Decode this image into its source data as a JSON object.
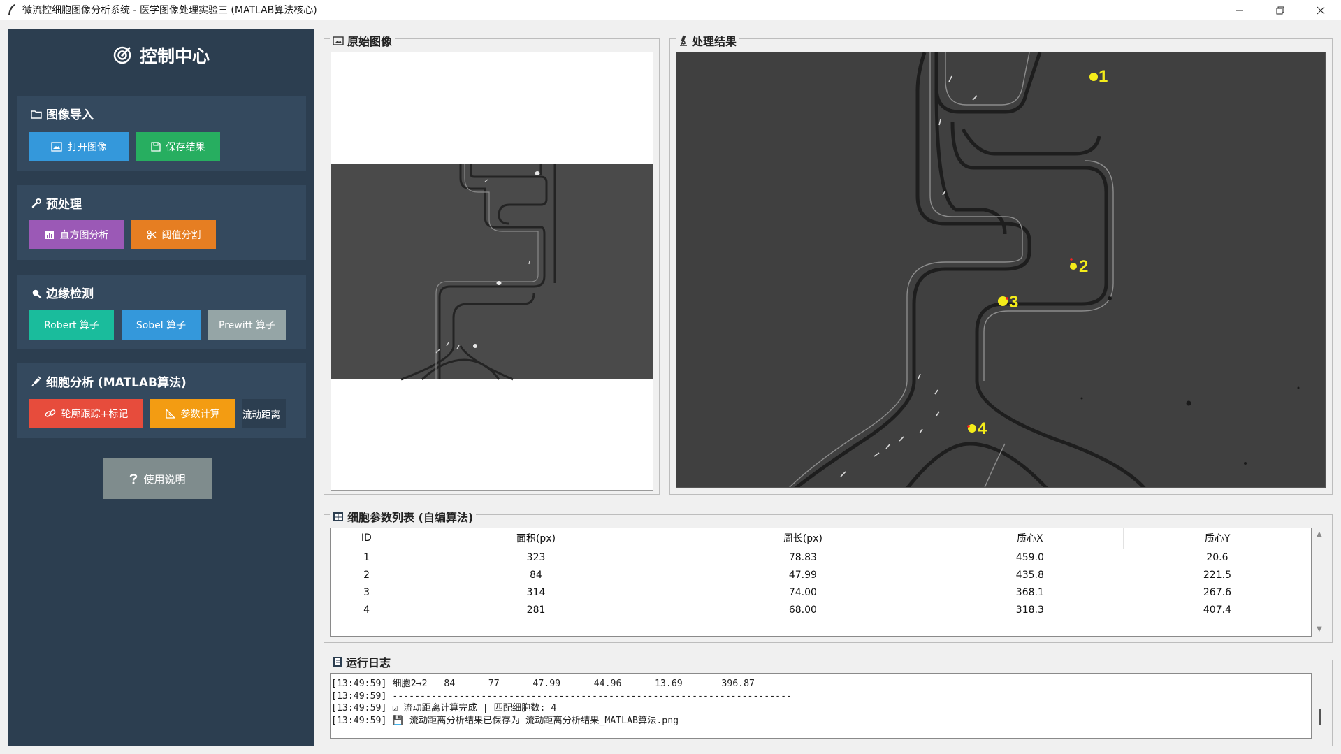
{
  "window": {
    "title": "微流控细胞图像分析系统 - 医学图像处理实验三 (MATLAB算法核心)",
    "controls": [
      "minimize-icon",
      "restore-icon",
      "close-icon"
    ]
  },
  "sidebar": {
    "title": "控制中心",
    "groups": [
      {
        "title": "图像导入",
        "icon": "folder-icon",
        "buttons": [
          {
            "label": "打开图像",
            "icon": "image-icon",
            "color": "#3498db"
          },
          {
            "label": "保存结果",
            "icon": "save-icon",
            "color": "#27ae60"
          }
        ]
      },
      {
        "title": "预处理",
        "icon": "wrench-icon",
        "buttons": [
          {
            "label": "直方图分析",
            "icon": "bar-chart-icon",
            "color": "#9b59b6"
          },
          {
            "label": "阈值分割",
            "icon": "scissors-icon",
            "color": "#e67e22"
          }
        ]
      },
      {
        "title": "边缘检测",
        "icon": "magnifier-icon",
        "buttons": [
          {
            "label": "Robert 算子",
            "color": "#1abc9c"
          },
          {
            "label": "Sobel 算子",
            "color": "#3498db"
          },
          {
            "label": "Prewitt 算子",
            "color": "#95a5a6"
          }
        ]
      },
      {
        "title": "细胞分析 (MATLAB算法)",
        "icon": "syringe-icon",
        "buttons": [
          {
            "label": "轮廓跟踪+标记",
            "icon": "link-icon",
            "color": "#e74c3c"
          },
          {
            "label": "参数计算",
            "icon": "triangle-ruler-icon",
            "color": "#f39c12"
          },
          {
            "label": "流动距离",
            "color": "#2c3e50"
          }
        ]
      }
    ],
    "help_button": {
      "label": "使用说明",
      "icon": "question-icon"
    }
  },
  "original_panel": {
    "label": "原始图像",
    "icon": "photo-icon"
  },
  "result_panel": {
    "label": "处理结果",
    "icon": "microscope-icon",
    "markers": [
      "1",
      "2",
      "3",
      "4"
    ]
  },
  "table_panel": {
    "label": "细胞参数列表 (自编算法)",
    "icon": "table-icon",
    "columns": [
      "ID",
      "面积(px)",
      "周长(px)",
      "质心X",
      "质心Y"
    ],
    "rows": [
      [
        "1",
        "323",
        "78.83",
        "459.0",
        "20.6"
      ],
      [
        "2",
        "84",
        "47.99",
        "435.8",
        "221.5"
      ],
      [
        "3",
        "314",
        "74.00",
        "368.1",
        "267.6"
      ],
      [
        "4",
        "281",
        "68.00",
        "318.3",
        "407.4"
      ]
    ]
  },
  "log_panel": {
    "label": "运行日志",
    "icon": "log-icon",
    "lines": [
      "[13:49:59] 细胞2→2   84      77      47.99      44.96      13.69       396.87",
      "[13:49:59] ------------------------------------------------------------------------",
      "[13:49:59] ☑ 流动距离计算完成 | 匹配细胞数: 4",
      "[13:49:59] 💾 流动距离分析结果已保存为 流动距离分析结果_MATLAB算法.png"
    ]
  }
}
